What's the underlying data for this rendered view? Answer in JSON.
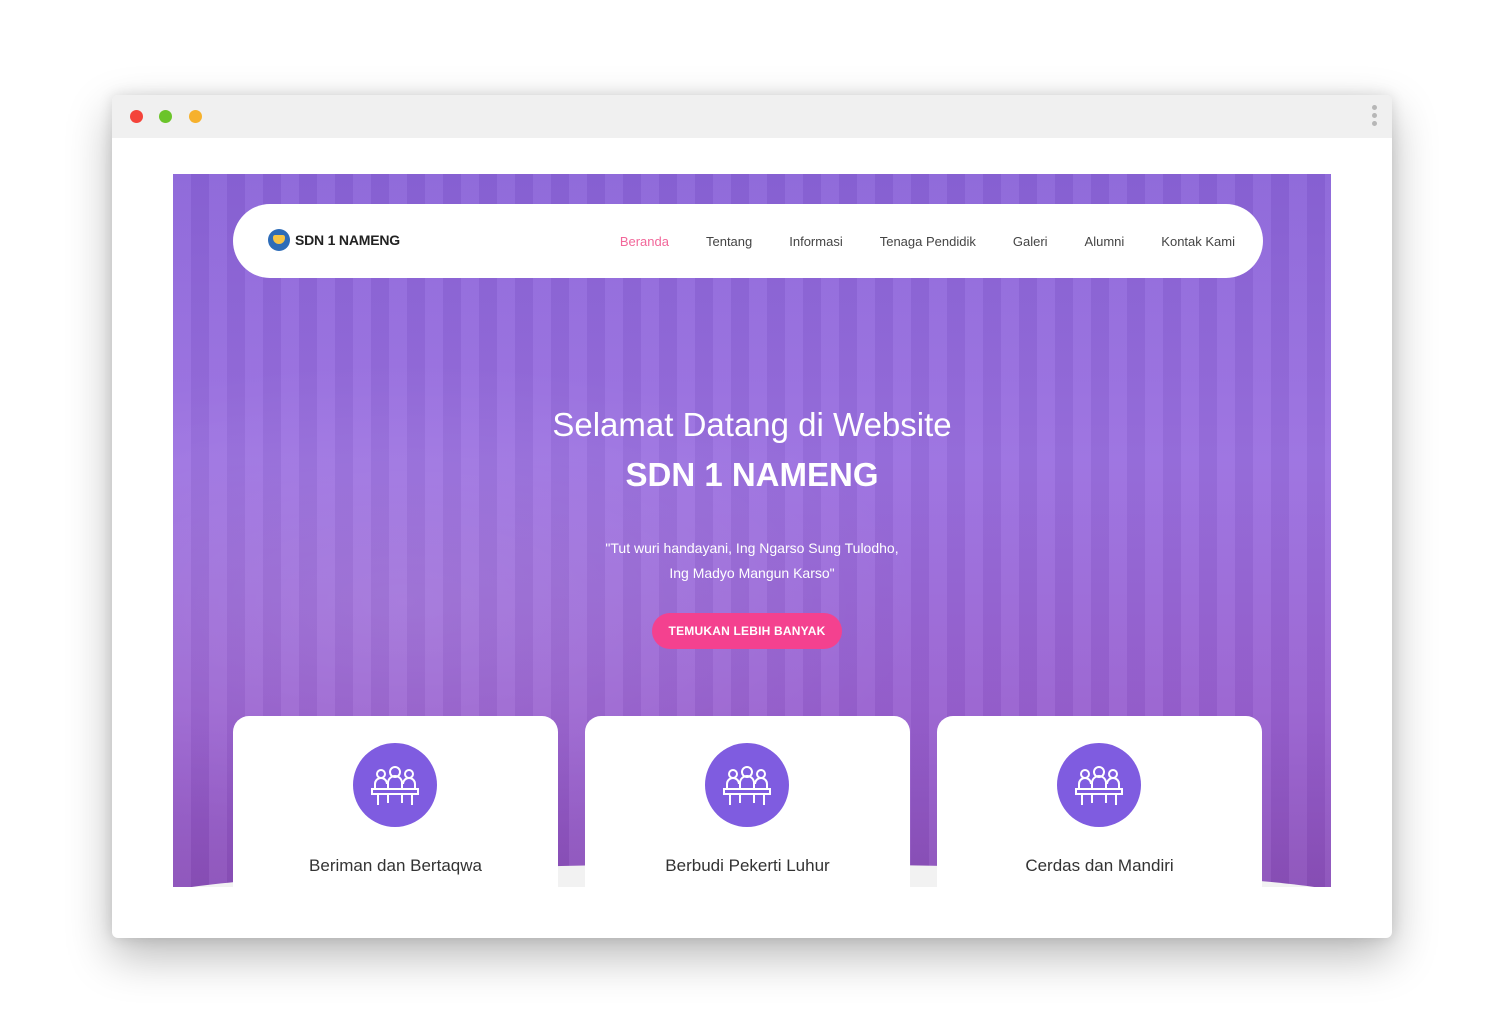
{
  "nav": {
    "brand": "SDN 1 NAMENG",
    "items": [
      {
        "label": "Beranda",
        "active": true
      },
      {
        "label": "Tentang",
        "active": false
      },
      {
        "label": "Informasi",
        "active": false
      },
      {
        "label": "Tenaga Pendidik",
        "active": false
      },
      {
        "label": "Galeri",
        "active": false
      },
      {
        "label": "Alumni",
        "active": false
      },
      {
        "label": "Kontak Kami",
        "active": false
      }
    ]
  },
  "hero": {
    "title_line1": "Selamat Datang di Website",
    "title_line2": "SDN 1 NAMENG",
    "quote_line1": "\"Tut wuri handayani, Ing Ngarso Sung Tulodho,",
    "quote_line2": "Ing Madyo Mangun Karso\"",
    "cta_label": "TEMUKAN LEBIH BANYAK"
  },
  "cards": [
    {
      "title": "Beriman dan Bertaqwa",
      "icon": "meeting-table-icon"
    },
    {
      "title": "Berbudi Pekerti Luhur",
      "icon": "meeting-table-icon"
    },
    {
      "title": "Cerdas dan Mandiri",
      "icon": "meeting-table-icon"
    }
  ],
  "colors": {
    "accent_pink": "#f4418f",
    "nav_active": "#f2679a",
    "icon_purple": "#7f5ce0",
    "hero_overlay": "#9a6fe0"
  }
}
